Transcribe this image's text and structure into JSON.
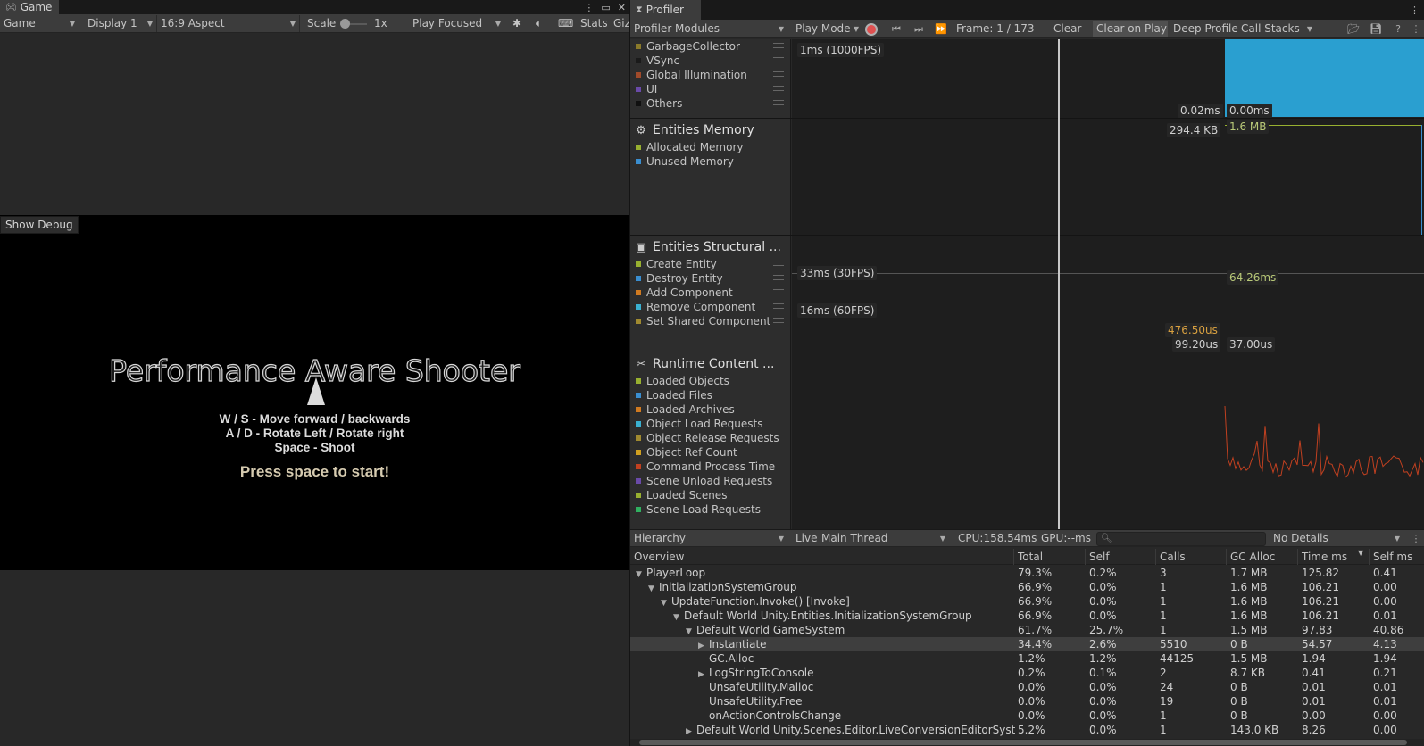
{
  "game": {
    "tab_title": "Game",
    "toolbar": {
      "view": "Game",
      "display": "Display 1",
      "aspect": "16:9 Aspect",
      "scale_label": "Scale",
      "scale_value": "1x",
      "play_mode": "Play Focused",
      "stats": "Stats",
      "gizmos": "Giz"
    },
    "show_debug": "Show Debug",
    "title": "Performance Aware Shooter",
    "instructions": [
      "W / S - Move forward / backwards",
      "A / D - Rotate Left / Rotate right",
      "Space - Shoot"
    ],
    "press_start": "Press space to start!"
  },
  "profiler": {
    "tab_title": "Profiler",
    "toolbar": {
      "modules": "Profiler Modules",
      "mode": "Play Mode",
      "frame": "Frame: 1 / 173",
      "clear": "Clear",
      "clear_on_play": "Clear on Play",
      "deep_profile": "Deep Profile",
      "call_stacks": "Call Stacks"
    },
    "cpu_legend": [
      {
        "name": "GarbageCollector",
        "color": "#8a7a2a"
      },
      {
        "name": "VSync",
        "color": "#1a1a1a"
      },
      {
        "name": "Global Illumination",
        "color": "#a04a2a"
      },
      {
        "name": "UI",
        "color": "#6a4aa8"
      },
      {
        "name": "Others",
        "color": "#101010"
      }
    ],
    "cpu_graph": {
      "fps_label": "1ms (1000FPS)",
      "left_value": "0.02ms",
      "right_value": "0.00ms",
      "fill_color": "#2a9fd0"
    },
    "entities_memory": {
      "title": "Entities Memory",
      "legend": [
        {
          "name": "Allocated Memory",
          "color": "#98b030"
        },
        {
          "name": "Unused Memory",
          "color": "#3a8ed0"
        }
      ],
      "left_value": "294.4 KB",
      "right_value": "1.6 MB"
    },
    "entities_structural": {
      "title": "Entities Structural ...",
      "legend": [
        {
          "name": "Create Entity",
          "color": "#98b030"
        },
        {
          "name": "Destroy Entity",
          "color": "#3a8ed0"
        },
        {
          "name": "Add Component",
          "color": "#d07a20"
        },
        {
          "name": "Remove Component",
          "color": "#3ab0d0"
        },
        {
          "name": "Set Shared Component",
          "color": "#a08a30"
        }
      ],
      "line_30fps": "33ms (30FPS)",
      "line_60fps": "16ms (60FPS)",
      "value_a": "64.26ms",
      "value_b": "476.50us",
      "value_c": "99.20us",
      "value_d": "37.00us"
    },
    "runtime_content": {
      "title": "Runtime Content ...",
      "legend": [
        {
          "name": "Loaded Objects",
          "color": "#98b030"
        },
        {
          "name": "Loaded Files",
          "color": "#3a8ed0"
        },
        {
          "name": "Loaded Archives",
          "color": "#d07a20"
        },
        {
          "name": "Object Load Requests",
          "color": "#3ab0d0"
        },
        {
          "name": "Object Release Requests",
          "color": "#a08a30"
        },
        {
          "name": "Object Ref Count",
          "color": "#d0a020"
        },
        {
          "name": "Command Process Time",
          "color": "#c04020"
        },
        {
          "name": "Scene Unload Requests",
          "color": "#6a4aa8"
        },
        {
          "name": "Loaded Scenes",
          "color": "#98b030"
        },
        {
          "name": "Scene Load Requests",
          "color": "#30b060"
        }
      ]
    },
    "hierarchy": {
      "view": "Hierarchy",
      "live": "Live",
      "thread": "Main Thread",
      "cpu": "CPU:158.54ms",
      "gpu": "GPU:--ms",
      "details": "No Details",
      "columns": [
        "Overview",
        "Total",
        "Self",
        "Calls",
        "GC Alloc",
        "Time ms",
        "Self ms"
      ],
      "rows": [
        {
          "name": "PlayerLoop",
          "fold": "▼",
          "total": "79.3%",
          "self": "0.2%",
          "calls": "3",
          "gc": "1.7 MB",
          "time": "125.82",
          "selfms": "0.41"
        },
        {
          "name": "InitializationSystemGroup",
          "fold": "▼",
          "total": "66.9%",
          "self": "0.0%",
          "calls": "1",
          "gc": "1.6 MB",
          "time": "106.21",
          "selfms": "0.00"
        },
        {
          "name": "UpdateFunction.Invoke() [Invoke]",
          "fold": "▼",
          "total": "66.9%",
          "self": "0.0%",
          "calls": "1",
          "gc": "1.6 MB",
          "time": "106.21",
          "selfms": "0.00"
        },
        {
          "name": "Default World Unity.Entities.InitializationSystemGroup",
          "fold": "▼",
          "total": "66.9%",
          "self": "0.0%",
          "calls": "1",
          "gc": "1.6 MB",
          "time": "106.21",
          "selfms": "0.01"
        },
        {
          "name": "Default World GameSystem",
          "fold": "▼",
          "total": "61.7%",
          "self": "25.7%",
          "calls": "1",
          "gc": "1.5 MB",
          "time": "97.83",
          "selfms": "40.86"
        },
        {
          "name": "Instantiate",
          "fold": "▶",
          "total": "34.4%",
          "self": "2.6%",
          "calls": "5510",
          "gc": "0 B",
          "time": "54.57",
          "selfms": "4.13"
        },
        {
          "name": "GC.Alloc",
          "fold": "",
          "total": "1.2%",
          "self": "1.2%",
          "calls": "44125",
          "gc": "1.5 MB",
          "time": "1.94",
          "selfms": "1.94"
        },
        {
          "name": "LogStringToConsole",
          "fold": "▶",
          "total": "0.2%",
          "self": "0.1%",
          "calls": "2",
          "gc": "8.7 KB",
          "time": "0.41",
          "selfms": "0.21"
        },
        {
          "name": "UnsafeUtility.Malloc",
          "fold": "",
          "total": "0.0%",
          "self": "0.0%",
          "calls": "24",
          "gc": "0 B",
          "time": "0.01",
          "selfms": "0.01"
        },
        {
          "name": "UnsafeUtility.Free",
          "fold": "",
          "total": "0.0%",
          "self": "0.0%",
          "calls": "19",
          "gc": "0 B",
          "time": "0.01",
          "selfms": "0.01"
        },
        {
          "name": "onActionControlsChange",
          "fold": "",
          "total": "0.0%",
          "self": "0.0%",
          "calls": "1",
          "gc": "0 B",
          "time": "0.00",
          "selfms": "0.00"
        },
        {
          "name": "Default World Unity.Scenes.Editor.LiveConversionEditorSystem",
          "fold": "▶",
          "total": "5.2%",
          "self": "0.0%",
          "calls": "1",
          "gc": "143.0 KB",
          "time": "8.26",
          "selfms": "0.00"
        }
      ]
    }
  }
}
